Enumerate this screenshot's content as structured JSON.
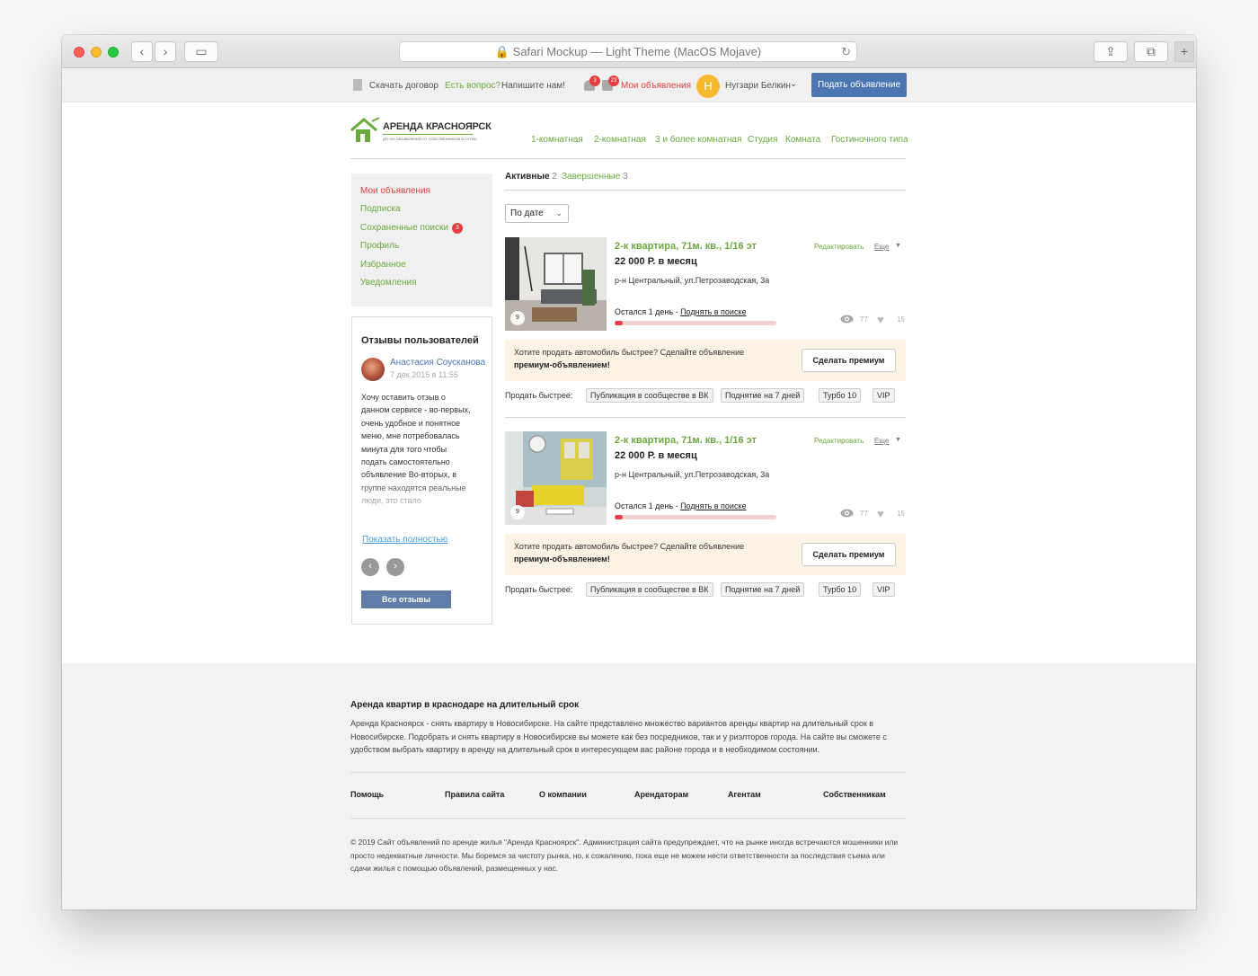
{
  "browser": {
    "url": "Safari Mockup — Light Theme (MacOS Mojave)"
  },
  "topbar": {
    "download": "Скачать договор",
    "question": "Есть вопрос?",
    "write_us": "Напишите нам!",
    "bell_count": "3",
    "msg_count": "23",
    "my_ads": "Мои объявления",
    "user_initial": "Н",
    "user_name": "Нугзари Белкин",
    "post_ad": "Подать объявление"
  },
  "logo": {
    "title": "АРЕНДА КРАСНОЯРСК",
    "subtitle": "ДО 100 ОБЪЯВЛЕНИЙ ОТ СОБСТВЕННИКОВ В СУТКИ"
  },
  "nav": [
    "1-комнатная",
    "2-комнатная",
    "3 и более комнатная",
    "Студия",
    "Комната",
    "Гостиночного типа"
  ],
  "sidebar": {
    "items": [
      "Мои объявления",
      "Подписка",
      "Сохраненные поиски",
      "Профиль",
      "Избранное",
      "Уведомления"
    ],
    "saved_badge": "3"
  },
  "reviews": {
    "title": "Отзывы пользователей",
    "author": "Анастасия Соусканова",
    "date": "7 дек 2015 в 11:55",
    "text": "Хочу оставить отзыв о данном сервисе - во-первых, очень удобное и понятное меню, мне потребовалась минута для того чтобы подать самостоятельно объявление Во-вторых, в группе находятся реальные люди, это стало",
    "show_more": "Показать полностью",
    "all_reviews": "Все отзывы"
  },
  "tabs": {
    "active_label": "Активные",
    "active_count": "2",
    "done_label": "Завершенные",
    "done_count": "3"
  },
  "sort": {
    "value": "По дате"
  },
  "listings": [
    {
      "title": "2-к квартира, 71м. кв., 1/16 эт",
      "price": "22 000 Р. в месяц",
      "address": "р-н Центральный, ул.Петрозаводская, 3а",
      "edit": "Редактировать",
      "more": "Еще",
      "left_text": "Остался 1 день - ",
      "lift": "Поднять в поиске",
      "progress": 0.05,
      "views": "77",
      "likes": "15",
      "photos": "9",
      "promo_text": "Хотите продать автомобиль быстрее? Сделайте объявление",
      "promo_bold": "премиум-объявлением!",
      "promo_button": "Сделать премиум",
      "sell_label": "Продать быстрее:",
      "chips": [
        "Публикация в сообществе в ВК",
        "Поднятие на 7 дней",
        "Турбо 10",
        "VIP"
      ]
    },
    {
      "title": "2-к квартира, 71м. кв., 1/16 эт",
      "price": "22 000 Р. в месяц",
      "address": "р-н Центральный, ул.Петрозаводская, 3а",
      "edit": "Редактировать",
      "more": "Еще",
      "left_text": "Остался 1 день - ",
      "lift": "Поднять в поиске",
      "progress": 0.05,
      "views": "77",
      "likes": "15",
      "photos": "9",
      "promo_text": "Хотите продать автомобиль быстрее? Сделайте объявление",
      "promo_bold": "премиум-объявлением!",
      "promo_button": "Сделать премиум",
      "sell_label": "Продать быстрее:",
      "chips": [
        "Публикация в сообществе в ВК",
        "Поднятие на 7 дней",
        "Турбо 10",
        "VIP"
      ]
    }
  ],
  "footer": {
    "title": "Аренда квартир в краснодаре на длительный срок",
    "text": "Аренда Красноярск - снять квартиру в Новосибирске. На сайте представлено множество вариантов аренды квартир на длительный срок в Новосибирске. Подобрать и снять квартиру в Новосибирске вы можете как без посредников, так и у риэлторов города. На сайте вы сможете с удобством выбрать квартиру в аренду на длительный срок в интересующем вас районе города и в необходимом состоянии.",
    "links": [
      "Помощь",
      "Правила сайта",
      "О компании",
      "Арендаторам",
      "Агентам",
      "Собственникам"
    ],
    "copyright": "© 2019 Сайт объявлений по аренде жилья \"Аренда Красноярск\". Администрация сайта предупреждает, что на рынке иногда встречаются мошенники или просто недекватные личности. Мы боремся за чистоту рынка, но, к сожалению, пока еще не можем нести ответственности за последствия съема или сдачи жилья с помощью объявлений, размещенных у нас."
  }
}
